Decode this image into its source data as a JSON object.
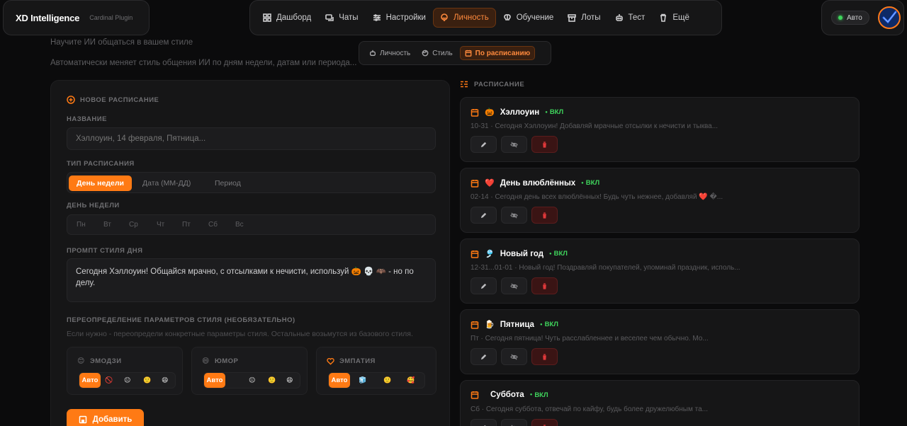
{
  "brand": {
    "name": "XD Intelligence",
    "sub": "Cardinal Plugin"
  },
  "nav": [
    {
      "label": "Дашборд",
      "icon": "dashboard-icon",
      "active": false
    },
    {
      "label": "Чаты",
      "icon": "chat-icon",
      "active": false
    },
    {
      "label": "Настройки",
      "icon": "sliders-icon",
      "active": false
    },
    {
      "label": "Личность",
      "icon": "smile-icon",
      "active": true
    },
    {
      "label": "Обучение",
      "icon": "brain-icon",
      "active": false
    },
    {
      "label": "Лоты",
      "icon": "box-icon",
      "active": false
    },
    {
      "label": "Тест",
      "icon": "bot-icon",
      "active": false
    },
    {
      "label": "Ещё",
      "icon": "trash-icon",
      "active": false
    }
  ],
  "user": {
    "mode_label": "Авто"
  },
  "subnav": [
    {
      "label": "Личность",
      "active": false
    },
    {
      "label": "Стиль",
      "active": false
    },
    {
      "label": "По расписанию",
      "active": true
    }
  ],
  "page": {
    "subtitle": "Научите ИИ общаться в вашем стиле",
    "description": "Автоматически меняет стиль общения ИИ по дням недели, датам или периода..."
  },
  "form": {
    "section_title": "Новое расписание",
    "name_label": "Название",
    "name_placeholder": "Хэллоуин, 14 февраля, Пятница...",
    "type_label": "Тип расписания",
    "type_options": [
      "День недели",
      "Дата (ММ-ДД)",
      "Период"
    ],
    "day_label": "День недели",
    "days": [
      "Пн",
      "Вт",
      "Ср",
      "Чт",
      "Пт",
      "Сб",
      "Вс"
    ],
    "prompt_label": "Промпт стиля дня",
    "prompt_value": "Сегодня Хэллоуин! Общайся мрачно, с отсылками к нечисти, используй 🎃 💀 🦇 - но по делу.",
    "override_label": "Переопределение параметров стиля (необязательно)",
    "override_hint": "Если нужно - переопредели конкретные параметры стиля. Остальные возьмутся из базового стиля.",
    "params": [
      {
        "label": "Эмодзи",
        "auto": "Авто",
        "dots": [
          "🚫",
          "😐",
          "🙂",
          "😄"
        ]
      },
      {
        "label": "Юмор",
        "auto": "Авто",
        "dots": [
          "😐",
          "🙂",
          "😄"
        ]
      },
      {
        "label": "Эмпатия",
        "auto": "Авто",
        "dots": [
          "🧊",
          "🙂",
          "🥰"
        ]
      }
    ],
    "add_label": "Добавить"
  },
  "schedule": {
    "title": "Расписание",
    "items": [
      {
        "emoji": "🎃",
        "title": "Хэллоуин",
        "status": "ВКЛ",
        "desc": "10-31 · Сегодня Хэллоуин! Добавляй мрачные отсылки к нечисти и тыква..."
      },
      {
        "emoji": "❤️",
        "title": "День влюблённых",
        "status": "ВКЛ",
        "desc": "02-14 · Сегодня день всех влюблённых! Будь чуть нежнее, добавляй ❤️ �..."
      },
      {
        "emoji": "🎐",
        "title": "Новый год",
        "status": "ВКЛ",
        "desc": "12-31...01-01 · Новый год! Поздравляй покупателей, упоминай праздник, исполь..."
      },
      {
        "emoji": "🍺",
        "title": "Пятница",
        "status": "ВКЛ",
        "desc": "Пт · Сегодня пятница! Чуть расслабленнее и веселее чем обычно. Мо..."
      },
      {
        "emoji": "",
        "title": "Суббота",
        "status": "ВКЛ",
        "desc": "Сб · Сегодня суббота, отвечай по кайфу, будь более дружелюбным та..."
      }
    ]
  },
  "colors": {
    "accent": "#ff7a14",
    "on": "#3fd45c",
    "danger": "#e0383a"
  }
}
